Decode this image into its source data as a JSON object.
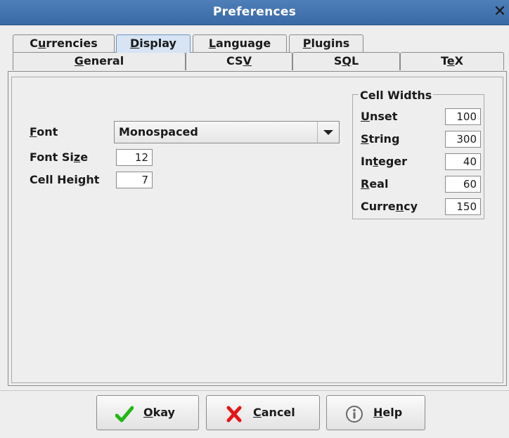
{
  "window": {
    "title": "Preferences",
    "close_glyph": "✕"
  },
  "tabs": {
    "row1": [
      {
        "pre": "C",
        "mn": "u",
        "post": "rrencies",
        "selected": false
      },
      {
        "pre": "",
        "mn": "D",
        "post": "isplay",
        "selected": true
      },
      {
        "pre": "",
        "mn": "L",
        "post": "anguage",
        "selected": false
      },
      {
        "pre": "",
        "mn": "P",
        "post": "lugins",
        "selected": false
      }
    ],
    "row2": [
      {
        "pre": "",
        "mn": "G",
        "post": "eneral",
        "selected": false
      },
      {
        "pre": "CS",
        "mn": "V",
        "post": "",
        "selected": false
      },
      {
        "pre": "S",
        "mn": "Q",
        "post": "L",
        "selected": false
      },
      {
        "pre": "T",
        "mn": "e",
        "post": "X",
        "selected": false
      }
    ]
  },
  "display": {
    "font": {
      "pre": "",
      "mn": "F",
      "post": "ont",
      "value": "Monospaced"
    },
    "font_size": {
      "pre": "Font Si",
      "mn": "z",
      "post": "e",
      "value": "12"
    },
    "cell_height": {
      "pre": "Cell Hei",
      "mn": "g",
      "post": "ht",
      "value": "7"
    }
  },
  "cell_widths": {
    "title": "Cell Widths",
    "rows": [
      {
        "pre": "",
        "mn": "U",
        "post": "nset",
        "value": "100"
      },
      {
        "pre": "",
        "mn": "S",
        "post": "tring",
        "value": "300"
      },
      {
        "pre": "In",
        "mn": "t",
        "post": "eger",
        "value": "40"
      },
      {
        "pre": "",
        "mn": "R",
        "post": "eal",
        "value": "60"
      },
      {
        "pre": "Curre",
        "mn": "n",
        "post": "cy",
        "value": "150"
      }
    ]
  },
  "buttons": {
    "okay": {
      "pre": "",
      "mn": "O",
      "post": "kay",
      "icon": "checkmark-icon",
      "color": "#22b814"
    },
    "cancel": {
      "pre": "",
      "mn": "C",
      "post": "ancel",
      "icon": "x-icon",
      "color": "#e81414"
    },
    "help": {
      "pre": "",
      "mn": "H",
      "post": "elp",
      "icon": "info-icon",
      "color": "#6a6a6a"
    }
  }
}
